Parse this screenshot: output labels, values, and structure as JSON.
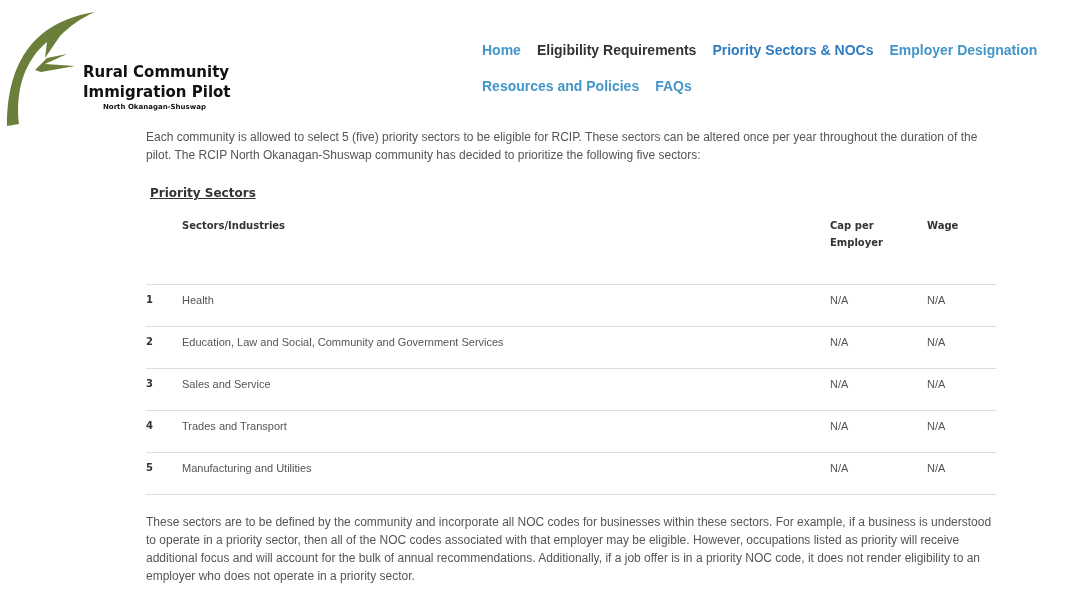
{
  "logo": {
    "title_line_1": "Rural Community",
    "title_line_2": "Immigration Pilot",
    "subtitle": "North Okanagan-Shuswap"
  },
  "nav": [
    {
      "label": "Home",
      "selected": false,
      "hovered": false
    },
    {
      "label": "Eligibility Requirements",
      "selected": false,
      "hovered": true
    },
    {
      "label": "Priority Sectors & NOCs",
      "selected": true,
      "hovered": false
    },
    {
      "label": "Employer Designation",
      "selected": false,
      "hovered": false
    },
    {
      "label": "Resources and Policies",
      "selected": false,
      "hovered": false
    },
    {
      "label": "FAQs",
      "selected": false,
      "hovered": false
    }
  ],
  "intro": "Each community is allowed to select 5 (five) priority sectors to be eligible for RCIP. These sectors can be altered once per year throughout the duration of the pilot. The RCIP North Okanagan-Shuswap community has decided to prioritize the following five sectors:",
  "section_heading": "Priority Sectors",
  "table": {
    "columns": [
      "Sectors/Industries",
      "Cap per Employer",
      "Wage"
    ],
    "rows": [
      {
        "number": "1",
        "sector": "Health",
        "cap": "N/A",
        "wage": "N/A"
      },
      {
        "number": "2",
        "sector": "Education, Law and Social, Community and Government Services",
        "cap": "N/A",
        "wage": "N/A"
      },
      {
        "number": "3",
        "sector": "Sales and Service",
        "cap": "N/A",
        "wage": "N/A"
      },
      {
        "number": "4",
        "sector": "Trades and Transport",
        "cap": "N/A",
        "wage": "N/A"
      },
      {
        "number": "5",
        "sector": "Manufacturing and Utilities",
        "cap": "N/A",
        "wage": "N/A"
      }
    ]
  },
  "outro": "These sectors are to be defined by the community and incorporate all NOC codes for businesses within these sectors. For example, if a business is understood to operate in a priority sector, then all of the NOC codes associated with that employer may be eligible. However, occupations listed as priority will receive additional focus and will account for the bulk of annual recommendations. Additionally, if a job offer is in a priority NOC code, it does not render eligibility to an employer who does not operate in a priority sector."
}
